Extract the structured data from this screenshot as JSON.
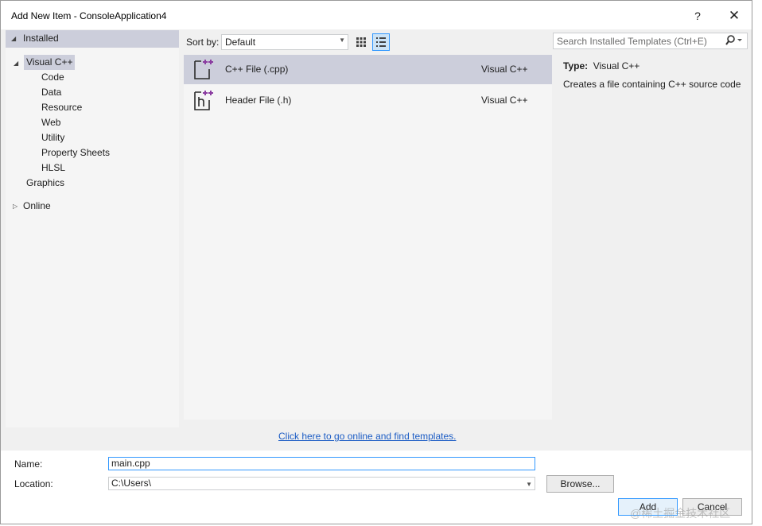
{
  "window": {
    "title": "Add New Item - ConsoleApplication4",
    "help_glyph": "?",
    "close_glyph": "✕"
  },
  "tree": {
    "installed": "Installed",
    "visual_cpp": "Visual C++",
    "children": [
      "Code",
      "Data",
      "Resource",
      "Web",
      "Utility",
      "Property Sheets",
      "HLSL"
    ],
    "graphics": "Graphics",
    "online": "Online"
  },
  "toolbar": {
    "sort_label": "Sort by:",
    "sort_value": "Default",
    "search_placeholder": "Search Installed Templates (Ctrl+E)"
  },
  "templates": [
    {
      "name": "C++ File (.cpp)",
      "lang": "Visual C++",
      "icon": "cpp-file-icon",
      "selected": true
    },
    {
      "name": "Header File (.h)",
      "lang": "Visual C++",
      "icon": "header-file-icon",
      "selected": false
    }
  ],
  "info": {
    "type_label": "Type:",
    "type_value": "Visual C++",
    "description": "Creates a file containing C++ source code"
  },
  "online_link": "Click here to go online and find templates.",
  "form": {
    "name_label": "Name:",
    "name_value": "main.cpp",
    "location_label": "Location:",
    "location_value": "C:\\Users\\"
  },
  "buttons": {
    "browse": "Browse...",
    "add": "Add",
    "cancel": "Cancel"
  },
  "watermark": "@稀土掘金技术社区",
  "colors": {
    "selection": "#cccedb",
    "accent": "#3399ff",
    "link": "#1a5bc4",
    "cpp_plus": "#8a3ca0"
  }
}
